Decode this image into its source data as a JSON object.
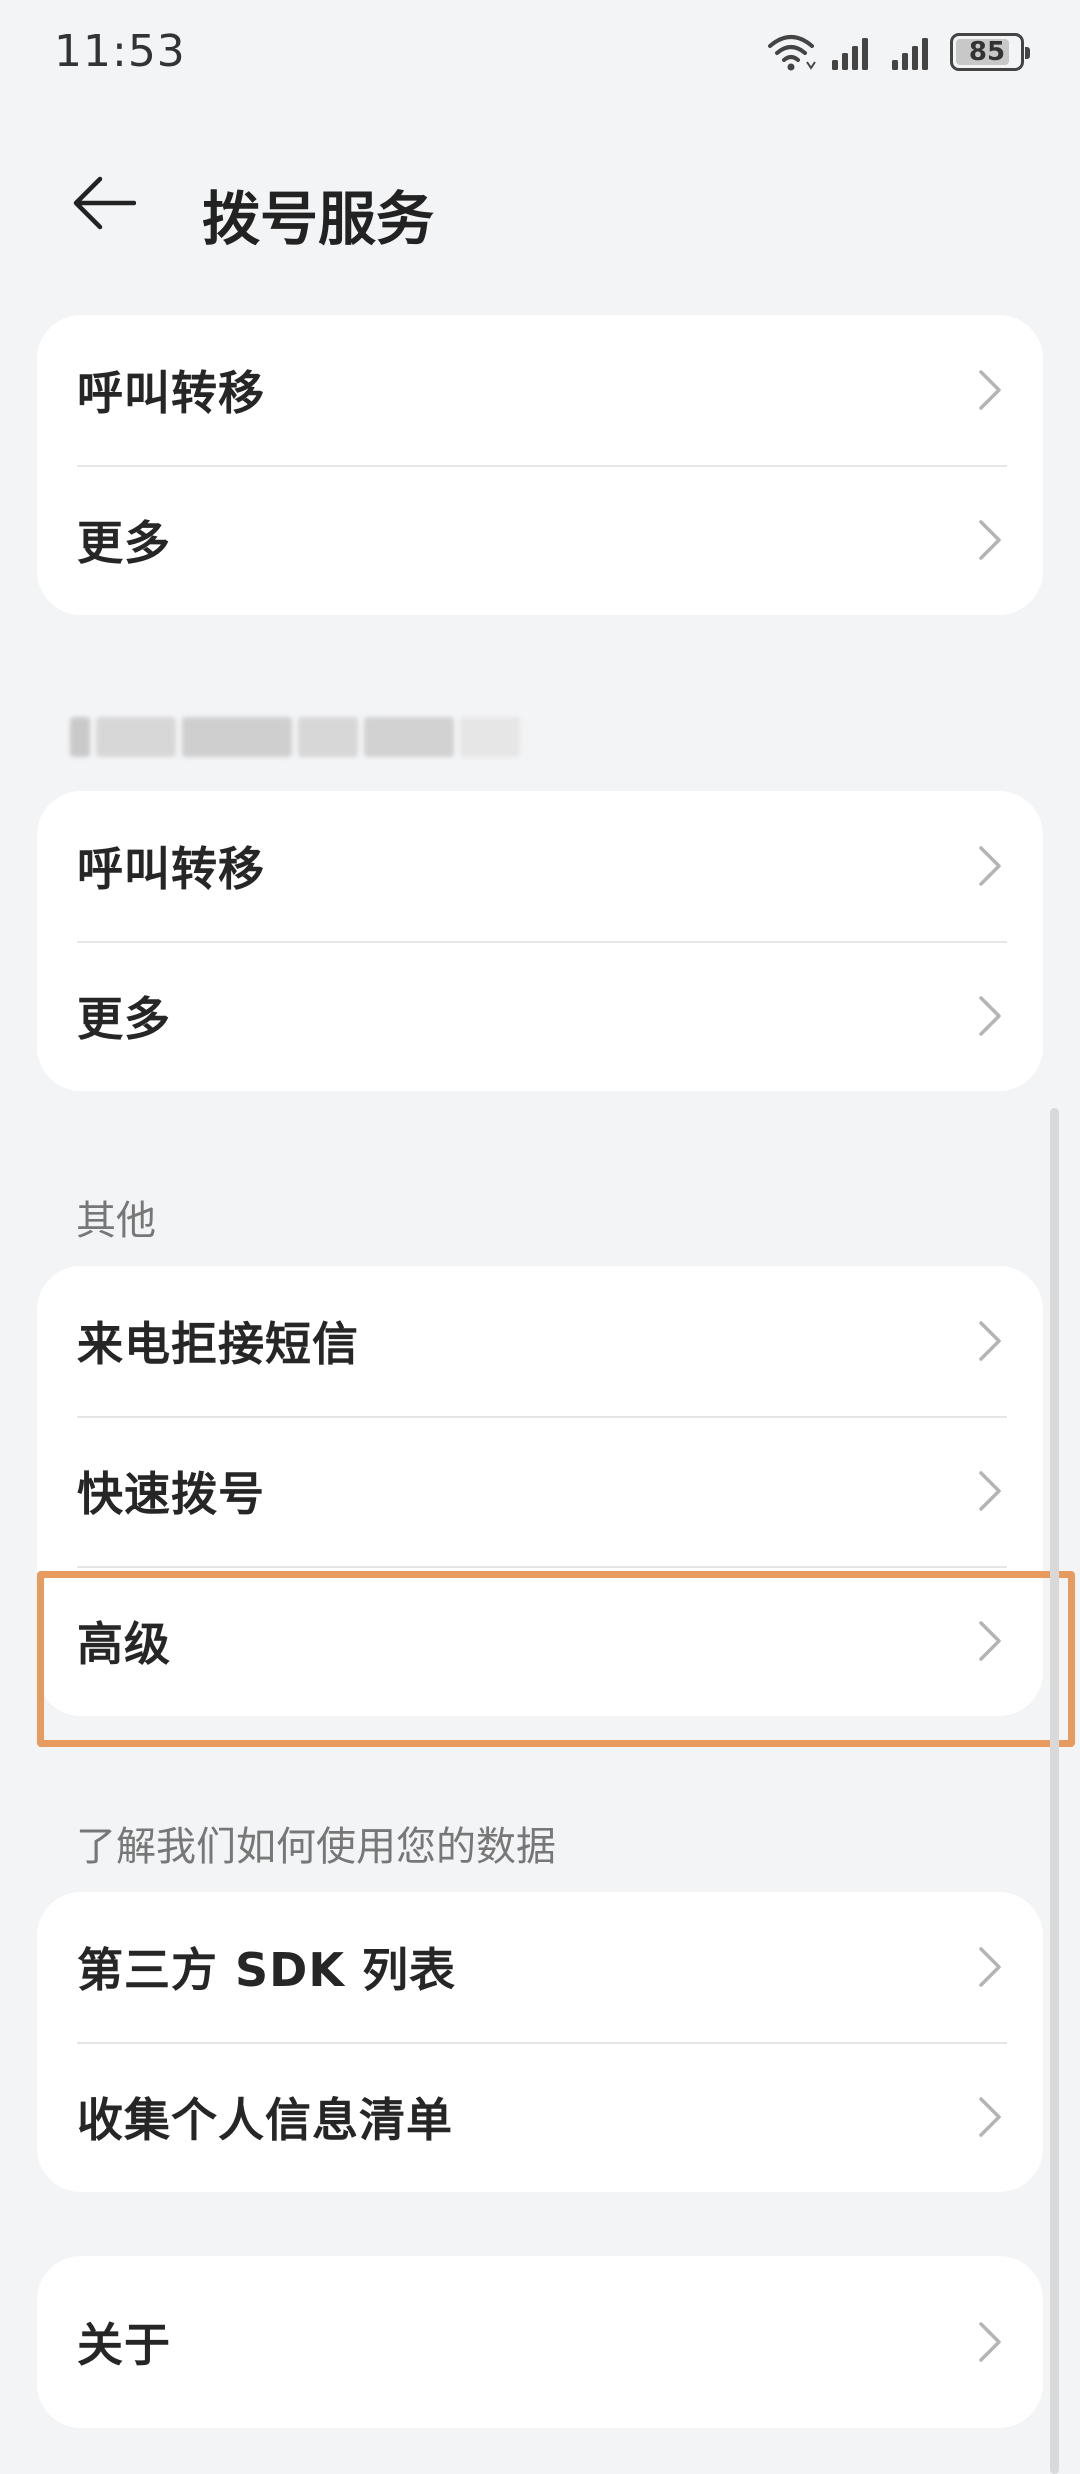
{
  "status_bar": {
    "time": "11:53",
    "battery": "85",
    "battery_level": 0.85,
    "icons": [
      "wifi-icon",
      "signal-icon",
      "signal-icon",
      "battery-icon"
    ]
  },
  "header": {
    "back_icon": "arrow-left-icon",
    "title": "拨号服务"
  },
  "sim1": {
    "items": [
      {
        "label": "呼叫转移",
        "icon": "chevron-right-icon"
      },
      {
        "label": "更多",
        "icon": "chevron-right-icon"
      }
    ]
  },
  "sim2": {
    "items": [
      {
        "label": "呼叫转移",
        "icon": "chevron-right-icon"
      },
      {
        "label": "更多",
        "icon": "chevron-right-icon"
      }
    ]
  },
  "other": {
    "title": "其他",
    "items": [
      {
        "label": "来电拒接短信",
        "icon": "chevron-right-icon"
      },
      {
        "label": "快速拨号",
        "icon": "chevron-right-icon"
      },
      {
        "label": "高级",
        "icon": "chevron-right-icon"
      }
    ]
  },
  "privacy": {
    "title": "了解我们如何使用您的数据",
    "items": [
      {
        "label": "第三方 SDK 列表",
        "icon": "chevron-right-icon"
      },
      {
        "label": "收集个人信息清单",
        "icon": "chevron-right-icon"
      }
    ]
  },
  "about": {
    "items": [
      {
        "label": "关于",
        "icon": "chevron-right-icon"
      }
    ]
  },
  "colors": {
    "background": "#f3f4f6",
    "card": "#ffffff",
    "highlight": "#e79b5f",
    "text": "#262626",
    "secondary_text": "#777777"
  }
}
